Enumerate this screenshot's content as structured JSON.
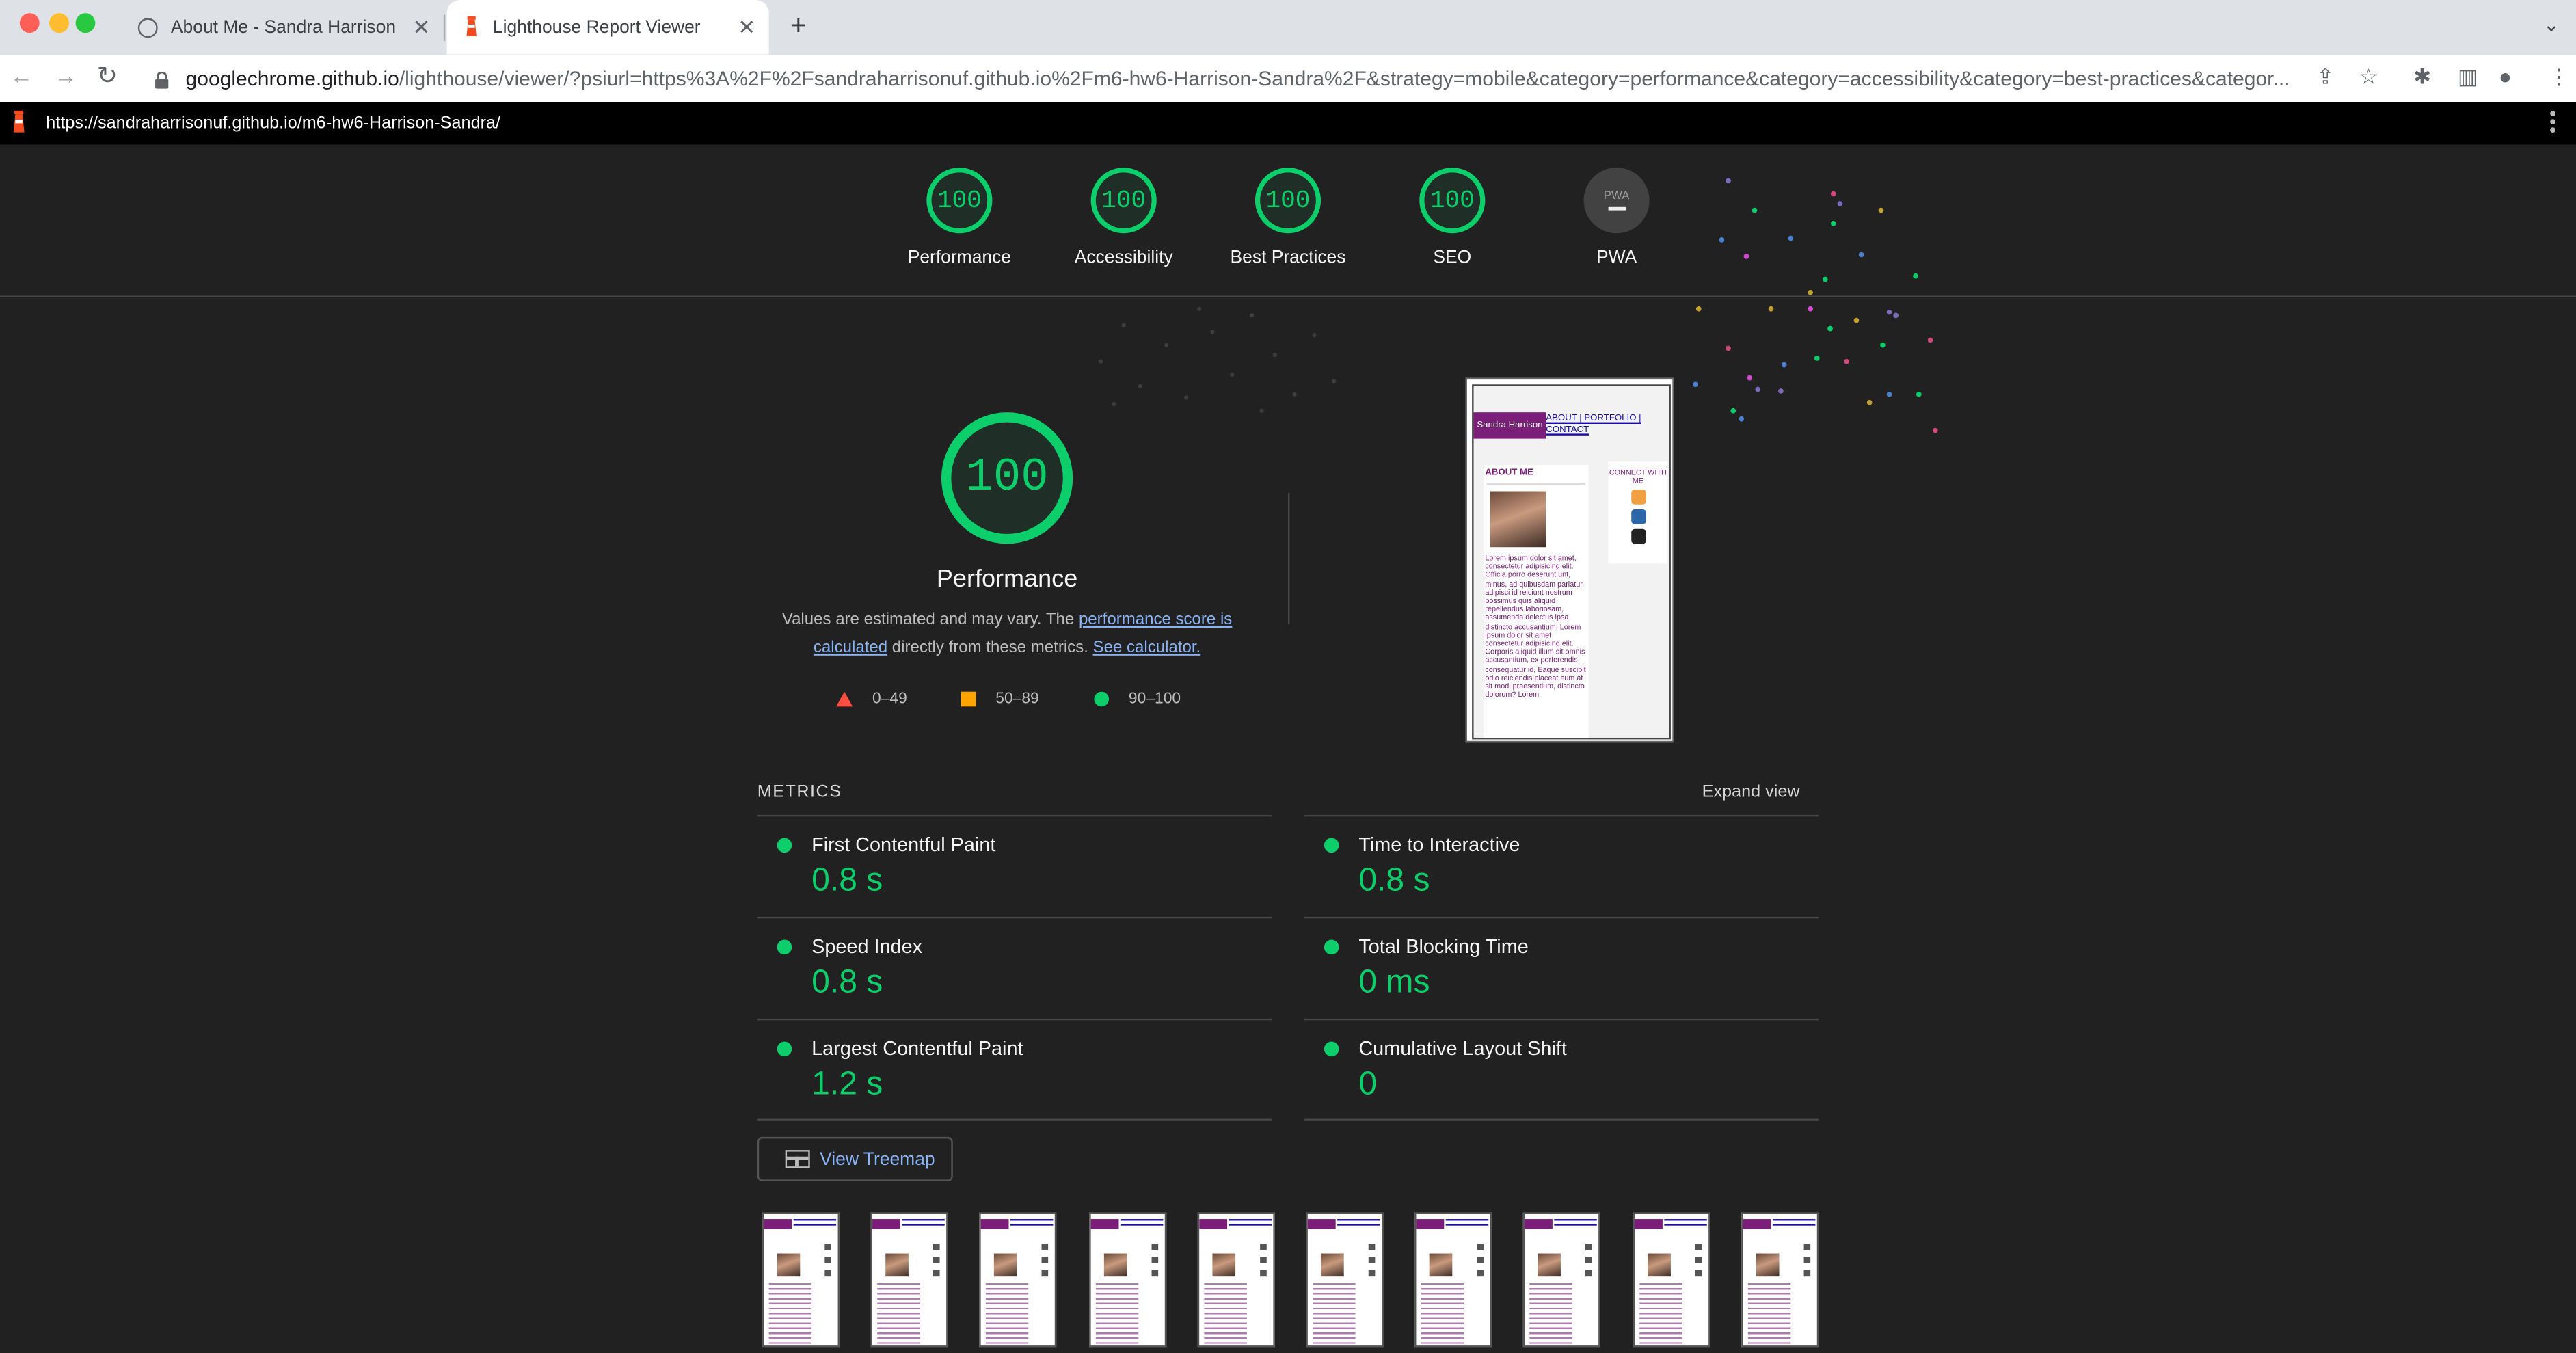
{
  "browser": {
    "tabs": [
      {
        "title": "About Me - Sandra Harrison",
        "icon": "globe-icon"
      },
      {
        "title": "Lighthouse Report Viewer",
        "icon": "lighthouse-icon"
      }
    ],
    "url_host": "googlechrome.github.io",
    "url_path": "/lighthouse/viewer/?psiurl=https%3A%2F%2Fsandraharrisonuf.github.io%2Fm6-hw6-Harrison-Sandra%2F&strategy=mobile&category=performance&category=accessibility&category=best-practices&categor..."
  },
  "report": {
    "url": "https://sandraharrisonuf.github.io/m6-hw6-Harrison-Sandra/",
    "gauges": [
      {
        "score": "100",
        "label": "Performance"
      },
      {
        "score": "100",
        "label": "Accessibility"
      },
      {
        "score": "100",
        "label": "Best Practices"
      },
      {
        "score": "100",
        "label": "SEO"
      },
      {
        "score": "PWA",
        "label": "PWA"
      }
    ],
    "performance": {
      "score": "100",
      "title": "Performance",
      "desc_prefix": "Values are estimated and may vary. The ",
      "desc_link1": "performance score is calculated",
      "desc_mid": " directly from these metrics. ",
      "desc_link2": "See calculator."
    },
    "legend": [
      {
        "range": "0–49",
        "color": "#ff4e42"
      },
      {
        "range": "50–89",
        "color": "#ffa400"
      },
      {
        "range": "90–100",
        "color": "#0cce6b"
      }
    ],
    "screenshot": {
      "site_name": "Sandra Harrison",
      "nav": "ABOUT | PORTFOLIO | CONTACT",
      "heading": "ABOUT ME",
      "connect": "CONNECT WITH ME",
      "lorem": "Lorem ipsum dolor sit amet, consectetur adipisicing elit. Officia porro deserunt unt, minus, ad quibusdam pariatur adipisci id reiciunt nostrum possimus quis aliquid repellendus laboriosam, assumenda delectus ipsa distincto accusantium. Lorem ipsum dolor sit amet consectetur adipisicing elit. Corporis aliquid illum sit omnis accusantium, ex perferendis consequatur id, Eaque suscipit odio reiciendis placeat eum at sit modi praesentium, distincto dolorum? Lorem"
    },
    "metrics_heading": "METRICS",
    "expand_label": "Expand view",
    "metrics": [
      {
        "name": "First Contentful Paint",
        "value": "0.8 s"
      },
      {
        "name": "Time to Interactive",
        "value": "0.8 s"
      },
      {
        "name": "Speed Index",
        "value": "0.8 s"
      },
      {
        "name": "Total Blocking Time",
        "value": "0 ms"
      },
      {
        "name": "Largest Contentful Paint",
        "value": "1.2 s"
      },
      {
        "name": "Cumulative Layout Shift",
        "value": "0"
      }
    ],
    "treemap_label": "View Treemap",
    "accent": "#0cce6b"
  }
}
